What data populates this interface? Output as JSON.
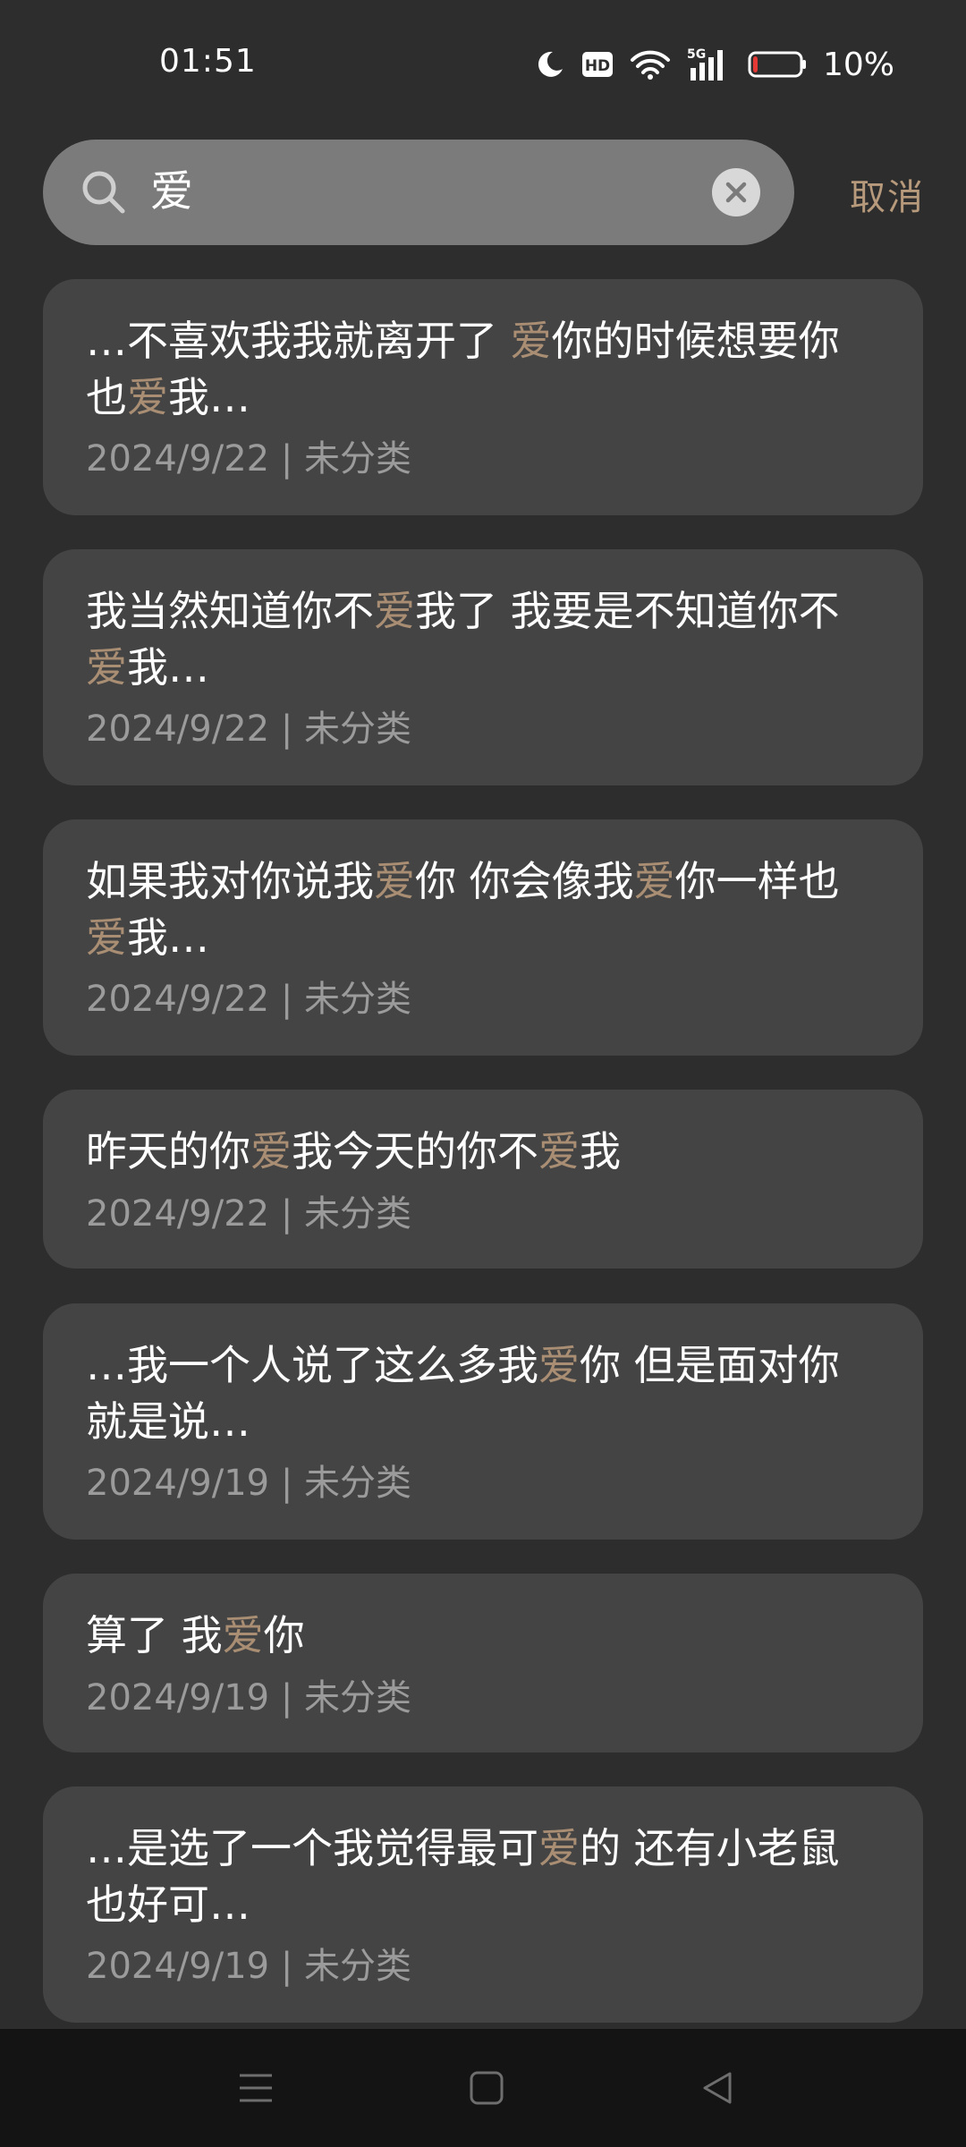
{
  "status_bar": {
    "time": "01:51",
    "icons": [
      "moon-icon",
      "hd-icon",
      "wifi-icon",
      "5g-signal-icon",
      "battery-icon"
    ],
    "network_label": "5G",
    "hd_label": "HD",
    "battery_percent": "10%",
    "battery_level": 0.1,
    "battery_color": "#e53935"
  },
  "search": {
    "query": "爱",
    "cancel_label": "取消"
  },
  "colors": {
    "highlight": "#a98e74",
    "cancel": "#b79a7c"
  },
  "results": [
    {
      "segments": [
        "…不喜欢我我就离开了 ",
        "爱",
        "你的时候想要你\n也",
        "爱",
        "我…"
      ],
      "date": "2024/9/22",
      "category": "未分类",
      "meta": "2024/9/22 | 未分类"
    },
    {
      "segments": [
        "我当然知道你不",
        "爱",
        "我了 我要是不知道你不\n",
        "爱",
        "我…"
      ],
      "date": "2024/9/22",
      "category": "未分类",
      "meta": "2024/9/22 | 未分类"
    },
    {
      "segments": [
        "如果我对你说我",
        "爱",
        "你 你会像我",
        "爱",
        "你一样也\n",
        "爱",
        "我…"
      ],
      "date": "2024/9/22",
      "category": "未分类",
      "meta": "2024/9/22 | 未分类"
    },
    {
      "segments": [
        "昨天的你",
        "爱",
        "我今天的你不",
        "爱",
        "我"
      ],
      "date": "2024/9/22",
      "category": "未分类",
      "meta": "2024/9/22 | 未分类"
    },
    {
      "segments": [
        "…我一个人说了这么多我",
        "爱",
        "你 但是面对你\n就是说…"
      ],
      "date": "2024/9/19",
      "category": "未分类",
      "meta": "2024/9/19 | 未分类"
    },
    {
      "segments": [
        "算了 我",
        "爱",
        "你"
      ],
      "date": "2024/9/19",
      "category": "未分类",
      "meta": "2024/9/19 | 未分类"
    },
    {
      "segments": [
        "…是选了一个我觉得最可",
        "爱",
        "的 还有小老鼠\n也好可…"
      ],
      "date": "2024/9/19",
      "category": "未分类",
      "meta": "2024/9/19 | 未分类"
    }
  ],
  "nav_bar": {
    "buttons": [
      "menu-icon",
      "home-icon",
      "back-icon"
    ]
  }
}
